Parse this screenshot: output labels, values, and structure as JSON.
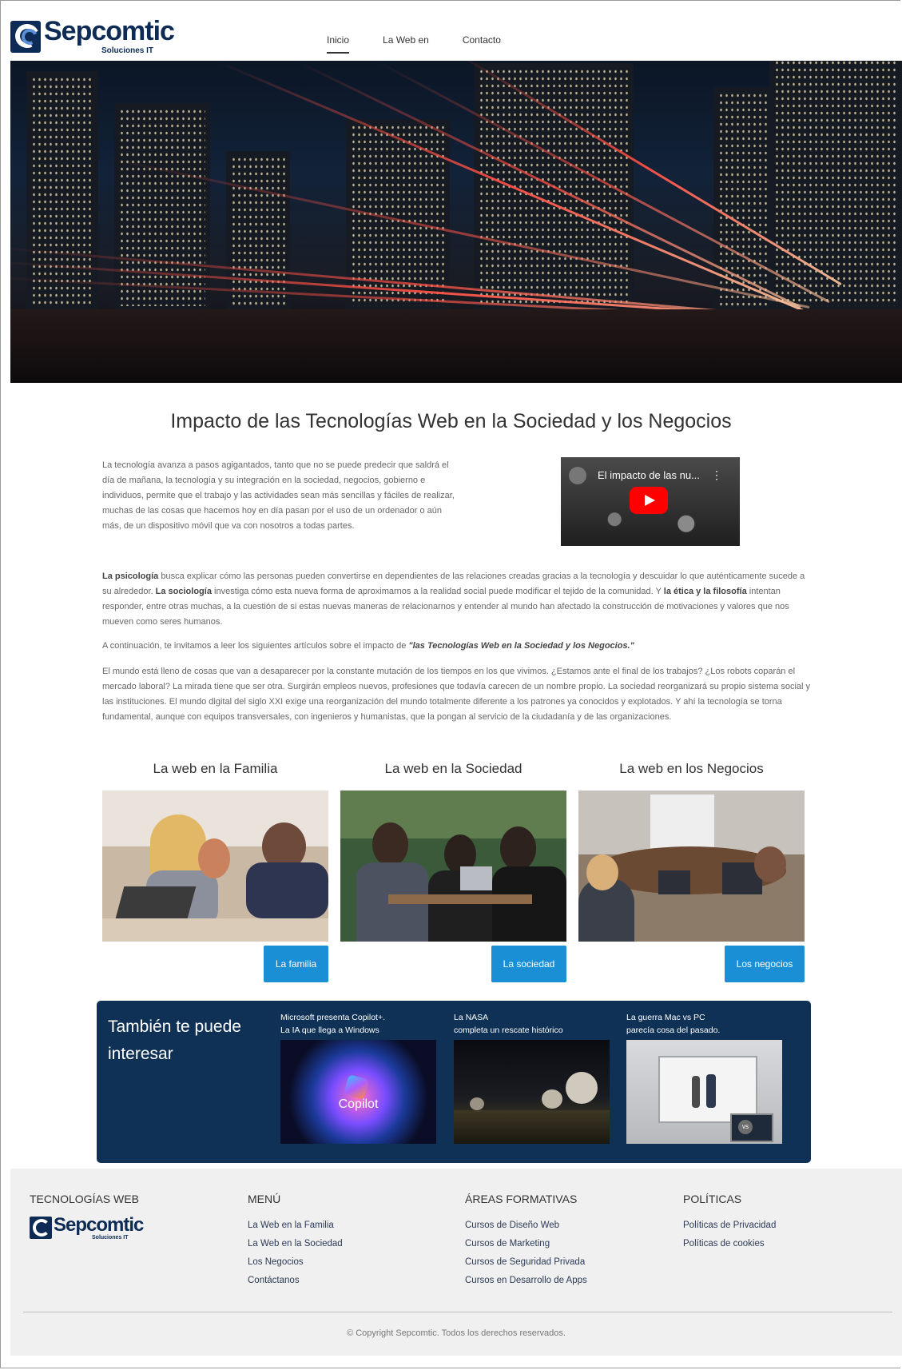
{
  "brand": {
    "name": "Sepcomtic",
    "tagline": "Soluciones IT"
  },
  "nav": {
    "items": [
      "Inicio",
      "La Web en",
      "Contacto"
    ],
    "active": "Inicio"
  },
  "main": {
    "title": "Impacto de las Tecnologías Web en la Sociedad y los Negocios",
    "intro": "La tecnología avanza a pasos agigantados, tanto que no se puede predecir que saldrá el día de mañana, la tecnología y su integración en la sociedad, negocios, gobierno e individuos, permite que el trabajo y las actividades sean más sencillas y fáciles de realizar, muchas de las cosas que hacemos hoy en día pasan por el uso de un ordenador o aún más, de un dispositivo móvil que va con nosotros a todas partes.",
    "video": {
      "title": "El impacto de las nu..."
    },
    "para2": {
      "psicologia": "La psicología",
      "p1": " busca explicar cómo las personas pueden convertirse en dependientes de las relaciones creadas gracias a la tecnología y descuidar lo que auténticamente sucede a su alrededor. ",
      "sociologia": "La sociología",
      "p2": " investiga cómo esta nueva forma de aproximarnos a la realidad social puede modificar el tejido de la comunidad. Y ",
      "etica": "la ética y la filosofía",
      "p3": " intentan responder, entre otras muchas, a la cuestión de si estas nuevas maneras de relacionarnos y entender al mundo han afectado la construcción de motivaciones y valores que nos mueven como seres humanos."
    },
    "para3": {
      "pre": "A continuación, te invitamos a leer los siguientes artículos sobre el impacto de ",
      "quote": "\"las Tecnologías Web en la Sociedad y los Negocios.\""
    },
    "para4": "El mundo está lleno de cosas que van a desaparecer por la constante mutación de los tiempos en los que vivimos. ¿Estamos ante el final de los trabajos? ¿Los robots coparán el mercado laboral? La mirada tiene que ser otra. Surgirán empleos nuevos, profesiones que todavía carecen de un nombre propio. La sociedad reorganizará su propio sistema social y las instituciones. El mundo digital del siglo XXI exige una reorganización del mundo totalmente diferente a los patrones ya conocidos y explotados. Y ahí la tecnología se torna fundamental, aunque con equipos transversales, con ingenieros y humanistas, que la pongan al servicio de la ciudadanía y de las organizaciones."
  },
  "cards": [
    {
      "title": "La web en la Familia",
      "button": "La familia"
    },
    {
      "title": "La web en la Sociedad",
      "button": "La sociedad"
    },
    {
      "title": "La web en los Negocios",
      "button": "Los negocios"
    }
  ],
  "interest": {
    "title": "También te puede interesar",
    "items": [
      {
        "line1": "Microsoft presenta Copilot+.",
        "line2": "La IA que llega a Windows",
        "img_text": "Copilot"
      },
      {
        "line1": "La NASA",
        "line2": "completa un rescate histórico"
      },
      {
        "line1": "La guerra Mac vs PC",
        "line2": "parecía cosa del pasado.",
        "img_text": "vs"
      }
    ]
  },
  "footer": {
    "col1": {
      "heading": "TECNOLOGÍAS WEB"
    },
    "col2": {
      "heading": "MENÚ",
      "links": [
        "La Web en la Familia",
        "La Web en la Sociedad",
        "Los Negocios",
        "Contáctanos"
      ]
    },
    "col3": {
      "heading": "ÁREAS FORMATIVAS",
      "links": [
        "Cursos de Diseño Web",
        "Cursos de Marketing",
        "Cursos de Seguridad Privada",
        "Cursos en Desarrollo de Apps"
      ]
    },
    "col4": {
      "heading": "POLÍTICAS",
      "links": [
        "Políticas de Privacidad",
        "Políticas de cookies"
      ]
    },
    "copyright": "© Copyright Sepcomtic. Todos los derechos reservados."
  },
  "colors": {
    "brand_navy": "#0d2b55",
    "accent_blue": "#1a8fd6",
    "interest_bg": "#0f3156",
    "footer_bg": "#f0f0f0"
  }
}
